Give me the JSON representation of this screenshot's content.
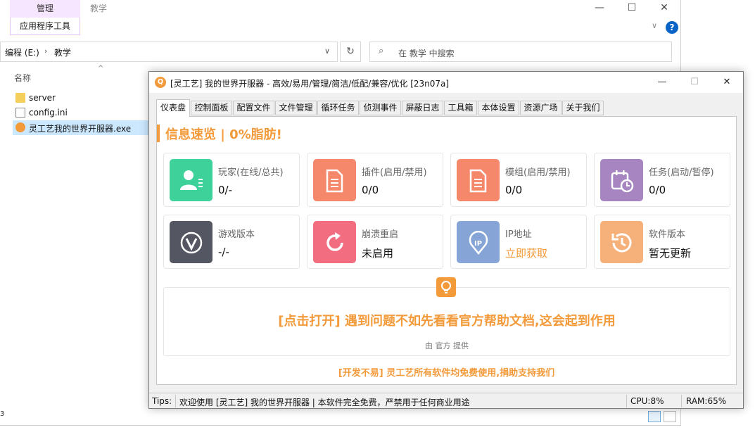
{
  "explorer": {
    "ribbon_manage": "管理",
    "ribbon_title": "教学",
    "ribbon_subtab": "应用程序工具",
    "window_controls": {
      "minimize": "—",
      "maximize": "☐",
      "close": "✕"
    },
    "address": {
      "drive": "编程 (E:)",
      "folder": "教学"
    },
    "search_placeholder": "在 教学 中搜索",
    "column_name": "名称",
    "files": [
      {
        "name": "server",
        "icon": "folder-icon"
      },
      {
        "name": "config.ini",
        "icon": "document-icon"
      },
      {
        "name": "灵工艺我的世界开服器.exe",
        "icon": "app-icon"
      }
    ],
    "status_digit": "3"
  },
  "app": {
    "title": "[灵工艺] 我的世界开服器 - 高效/易用/管理/简洁/低配/兼容/优化 [23n07a]",
    "logo_letter": "Q",
    "controls": {
      "minimize": "—",
      "maximize": "☐",
      "close": "✕"
    },
    "tabs": [
      "仪表盘",
      "控制面板",
      "配置文件",
      "文件管理",
      "循环任务",
      "侦测事件",
      "屏蔽日志",
      "工具箱",
      "本体设置",
      "资源广场",
      "关于我们"
    ],
    "active_tab": "仪表盘",
    "headline": "信息速览 | 0%脂肪!",
    "cards": [
      {
        "label": "玩家(在线/总共)",
        "value": "0/-",
        "color": "#3ed19a",
        "icon": "user-icon"
      },
      {
        "label": "插件(启用/禁用)",
        "value": "0/0",
        "color": "#f5876a",
        "icon": "document-icon"
      },
      {
        "label": "模组(启用/禁用)",
        "value": "0/0",
        "color": "#f5876a",
        "icon": "document-icon"
      },
      {
        "label": "任务(启动/暂停)",
        "value": "0/0",
        "color": "#a785c0",
        "icon": "calendar-clock-icon"
      },
      {
        "label": "游戏版本",
        "value": "-/-",
        "color": "#545661",
        "icon": "version-v-icon"
      },
      {
        "label": "崩溃重启",
        "value": "未启用",
        "color": "#f36d80",
        "icon": "restart-icon"
      },
      {
        "label": "IP地址",
        "value": "立即获取",
        "color": "#86a5d6",
        "icon": "ip-pin-icon"
      },
      {
        "label": "软件版本",
        "value": "暂无更新",
        "color": "#f6b07a",
        "icon": "history-icon"
      }
    ],
    "help_title": "[点击打开] 遇到问题不如先看看官方帮助文档,这会起到作用",
    "help_sub": "由 官方 提供",
    "donate": "[开发不易] 灵工艺所有软件均免费使用,捐助支持我们",
    "status": {
      "tips_label": "Tips:",
      "tips_text": "欢迎使用 [灵工艺] 我的世界开服器 | 本软件完全免费，严禁用于任何商业用途",
      "cpu": "CPU:8%",
      "ram": "RAM:65%"
    },
    "accent_color": "#f39a3a"
  }
}
